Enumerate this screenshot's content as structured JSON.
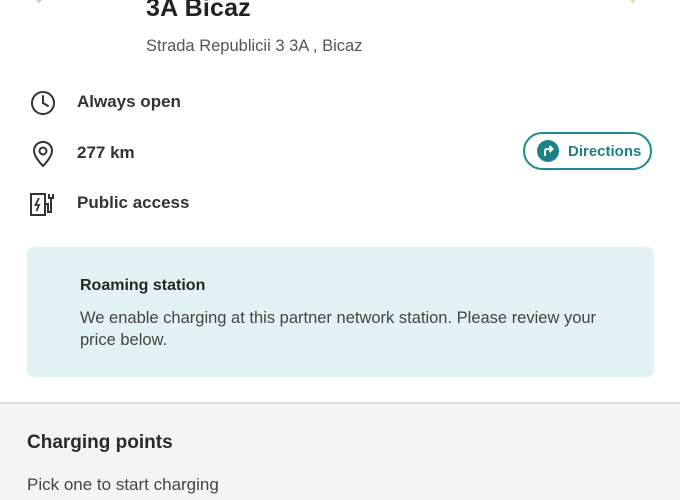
{
  "station": {
    "name": "3A Bicaz",
    "address": "Strada Republicii 3 3A , Bicaz"
  },
  "info": {
    "hours": {
      "icon": "clock-icon",
      "text": "Always open"
    },
    "distance": {
      "icon": "location-pin-icon",
      "text": "277 km"
    },
    "access": {
      "icon": "charging-station-icon",
      "text": "Public access"
    }
  },
  "directions_button": {
    "icon": "turn-right-arrow-icon",
    "label": "Directions"
  },
  "roaming": {
    "title": "Roaming station",
    "description": "We enable charging at this partner network station. Please review your price below."
  },
  "charging_points": {
    "title": "Charging points",
    "subtitle": "Pick one to start charging"
  },
  "colors": {
    "accent": "#1f8a93",
    "roaming_bg": "#e2f2f4",
    "section_bg": "#f4f4f4"
  }
}
